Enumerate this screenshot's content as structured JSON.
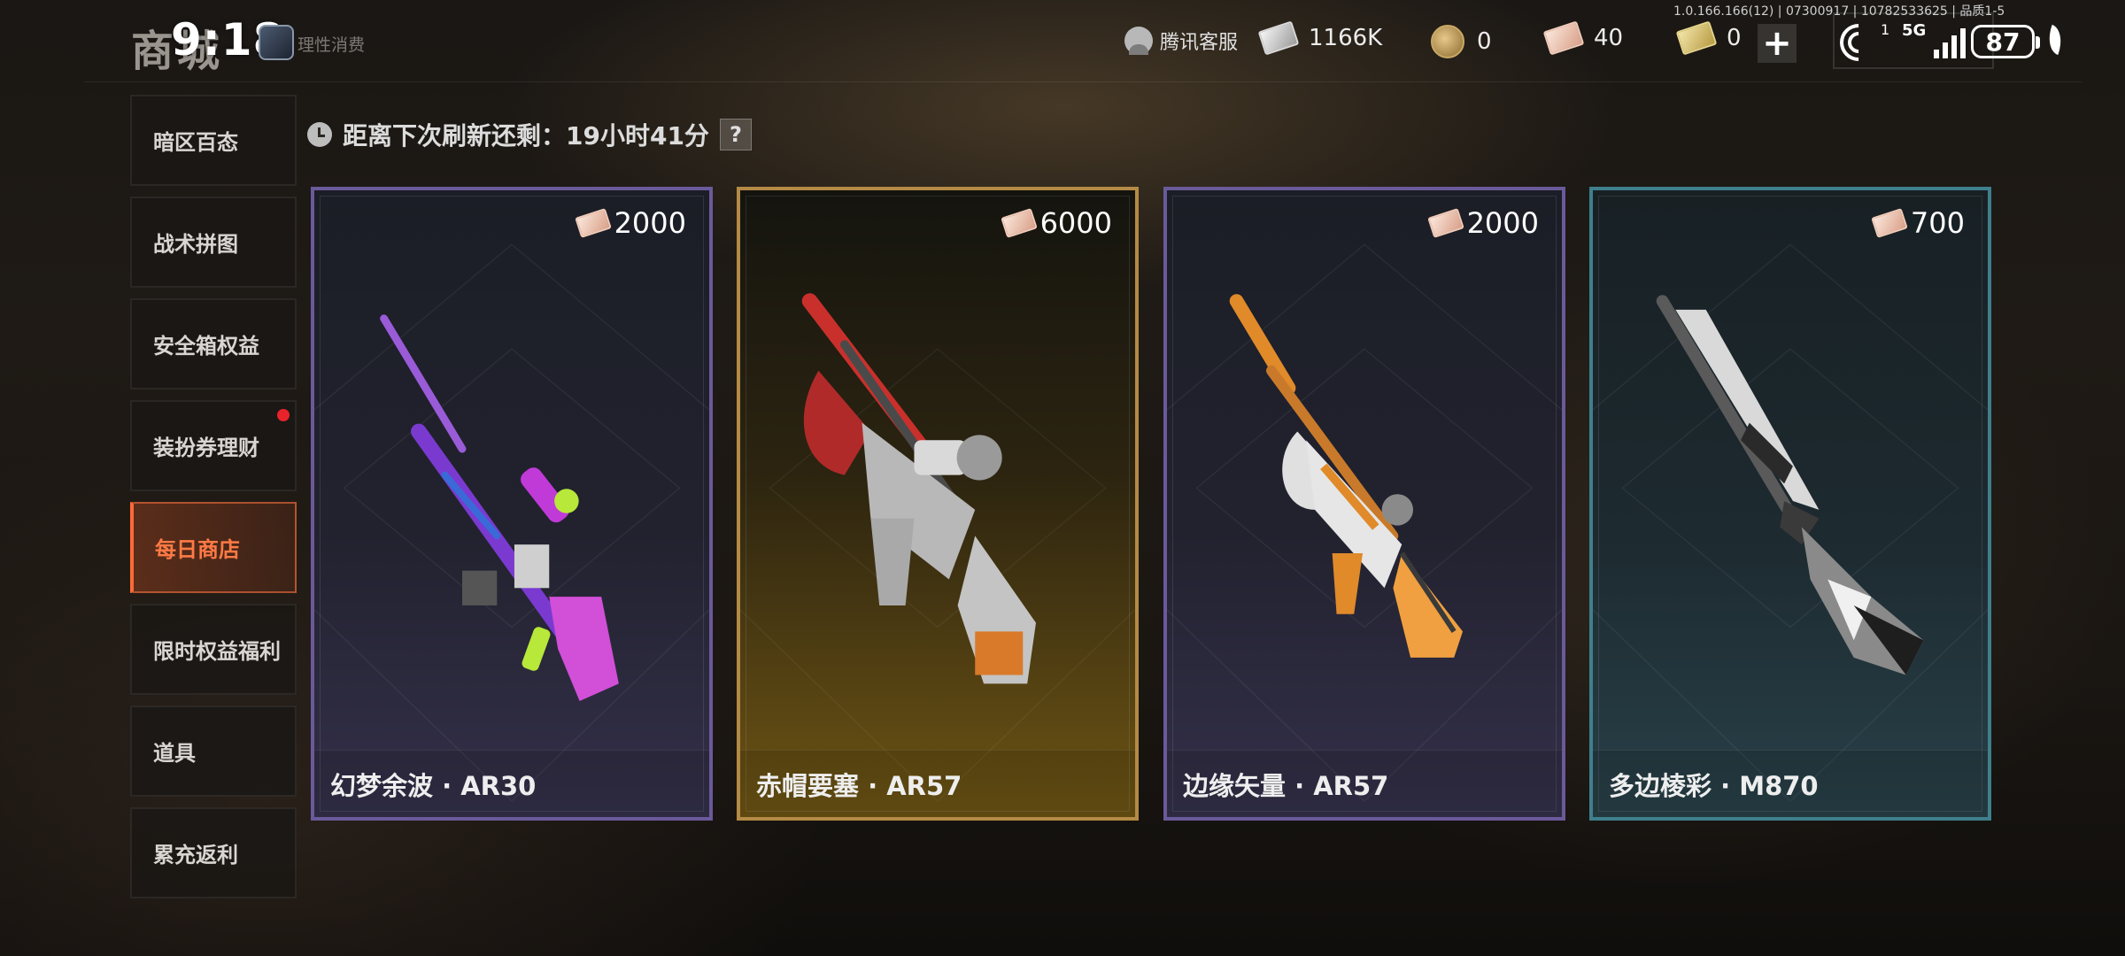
{
  "header": {
    "title": "商城",
    "time": "9:18",
    "rational_spending": "理性消费",
    "customer_service": "腾讯客服",
    "version_info": "1.0.166.166(12) | 07300917 | 10782533625 | 品质1-5"
  },
  "currencies": [
    {
      "name": "silver-ticket",
      "value": "1166K"
    },
    {
      "name": "coin",
      "value": "0"
    },
    {
      "name": "dress-ticket",
      "value": "40"
    },
    {
      "name": "gold-ticket",
      "value": "0"
    }
  ],
  "status_bar": {
    "sim": "1",
    "network": "5G",
    "battery": "87"
  },
  "sidebar": {
    "items": [
      {
        "label": "暗区百态",
        "active": false,
        "badge": false
      },
      {
        "label": "战术拼图",
        "active": false,
        "badge": false
      },
      {
        "label": "安全箱权益",
        "active": false,
        "badge": false
      },
      {
        "label": "装扮券理财",
        "active": false,
        "badge": true
      },
      {
        "label": "每日商店",
        "active": true,
        "badge": false
      },
      {
        "label": "限时权益福利",
        "active": false,
        "badge": false
      },
      {
        "label": "道具",
        "active": false,
        "badge": false
      },
      {
        "label": "累充返利",
        "active": false,
        "badge": false
      }
    ]
  },
  "refresh": {
    "text": "距离下次刷新还剩：19小时41分",
    "help_label": "?"
  },
  "cards": [
    {
      "name": "幻梦余波 · AR30",
      "price": "2000",
      "rarity": "purple",
      "colors": [
        "#a24fd8",
        "#3a6ad8",
        "#b7e83a"
      ]
    },
    {
      "name": "赤帽要塞 · AR57",
      "price": "6000",
      "rarity": "gold",
      "colors": [
        "#c9302c",
        "#b8b8b8",
        "#d97a2a"
      ]
    },
    {
      "name": "边缘矢量 · AR57",
      "price": "2000",
      "rarity": "purple",
      "colors": [
        "#e08a2a",
        "#d9d9d9",
        "#3a3a3a"
      ]
    },
    {
      "name": "多边棱彩 · M870",
      "price": "700",
      "rarity": "teal",
      "colors": [
        "#f0f0f0",
        "#6e6e6e",
        "#1e1e1e"
      ]
    }
  ]
}
